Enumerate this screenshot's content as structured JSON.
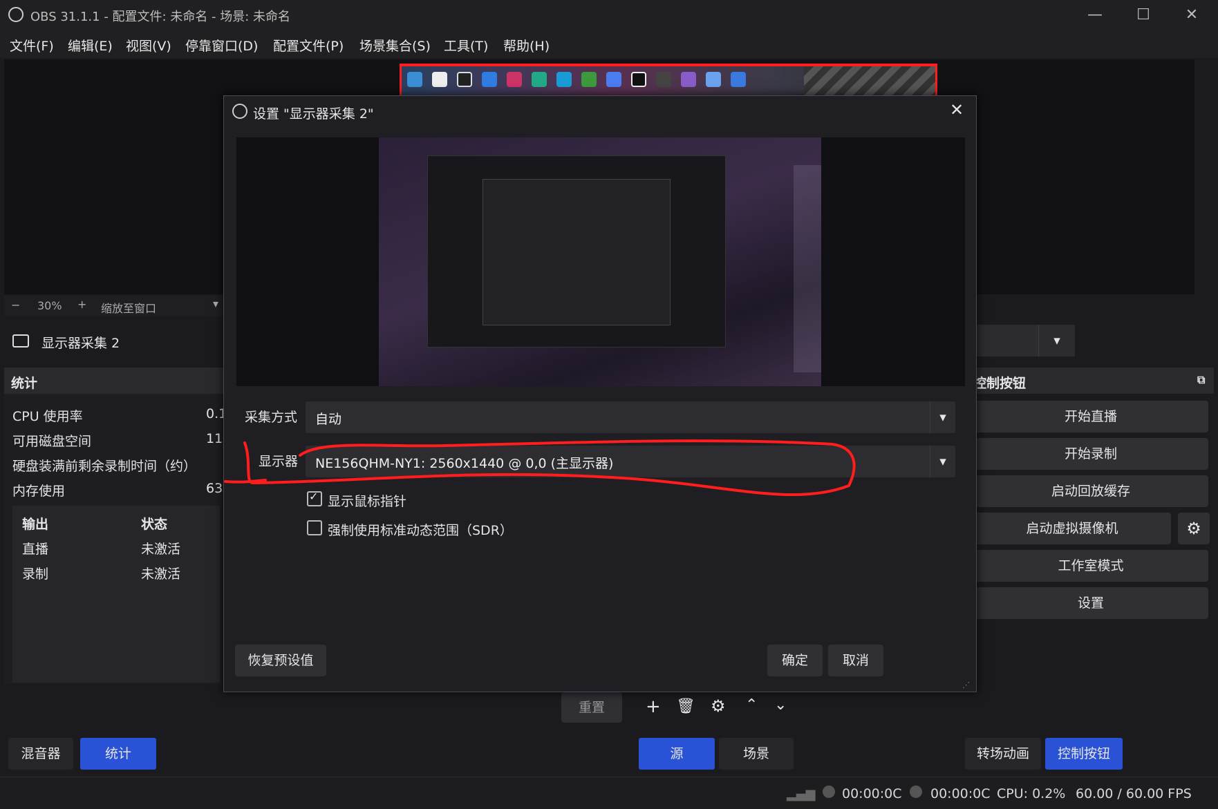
{
  "window": {
    "title": "OBS 31.1.1 - 配置文件: 未命名 - 场景: 未命名"
  },
  "menu": [
    "文件(F)",
    "编辑(E)",
    "视图(V)",
    "停靠窗口(D)",
    "配置文件(P)",
    "场景集合(S)",
    "工具(T)",
    "帮助(H)"
  ],
  "preview_bar": {
    "zoom_minus": "−",
    "zoom_level": "30%",
    "zoom_plus": "+",
    "zoom_mode": "缩放至窗口"
  },
  "source": {
    "name": "显示器采集 2"
  },
  "stats": {
    "header": "统计",
    "rows": [
      {
        "label": "CPU 使用率",
        "value": "0.1"
      },
      {
        "label": "可用磁盘空间",
        "value": "11("
      },
      {
        "label": "硬盘装满前剩余录制时间（约）",
        "value": ""
      },
      {
        "label": "内存使用",
        "value": "63"
      }
    ],
    "table_headers": [
      "输出",
      "状态"
    ],
    "table_rows": [
      {
        "output": "直播",
        "status": "未激活"
      },
      {
        "output": "录制",
        "status": "未激活"
      }
    ],
    "reset_label": "重置"
  },
  "controls": {
    "header": "控制按钮",
    "start_stream": "开始直播",
    "start_record": "开始录制",
    "start_replay": "启动回放缓存",
    "start_virtualcam": "启动虚拟摄像机",
    "studio_mode": "工作室模式",
    "settings": "设置"
  },
  "dialog": {
    "title": "设置 \"显示器采集 2\"",
    "capture_method_label": "采集方式",
    "capture_method_value": "自动",
    "display_label": "显示器",
    "display_value": "NE156QHM-NY1: 2560x1440 @ 0,0 (主显示器)",
    "show_cursor_label": "显示鼠标指针",
    "show_cursor_checked": true,
    "force_sdr_label": "强制使用标准动态范围（SDR）",
    "force_sdr_checked": false,
    "defaults_button": "恢复预设值",
    "ok_button": "确定",
    "cancel_button": "取消"
  },
  "tabs": {
    "mixer": "混音器",
    "stats": "统计",
    "sources": "源",
    "scenes": "场景",
    "transitions": "转场动画",
    "controls": "控制按钮"
  },
  "statusbar": {
    "stream_time": "00:00:0C",
    "record_time": "00:00:0C",
    "cpu": "CPU: 0.2%",
    "fps": "60.00 / 60.00 FPS"
  },
  "colors": {
    "accent_blue": "#2a52d6",
    "annotation_red": "#ff1d1d"
  }
}
